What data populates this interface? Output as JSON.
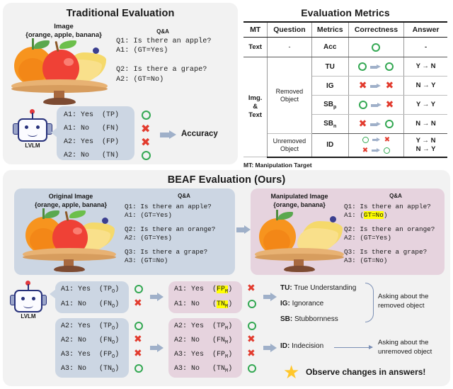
{
  "traditional": {
    "title": "Traditional Evaluation",
    "image_label_line1": "Image",
    "image_label_line2": "{orange, apple, banana}",
    "qa_label": "Q&A",
    "qa_text": "Q1: Is there an apple?\nA1: (GT=Yes)\n\nQ2: Is there a grape?\nA2: (GT=No)",
    "robot_label": "LVLM",
    "answers": [
      {
        "text": "A1: Yes  (TP)",
        "correct": "circle"
      },
      {
        "text": "A1: No   (FN)",
        "correct": "cross"
      },
      {
        "text": "A2: Yes  (FP)",
        "correct": "cross"
      },
      {
        "text": "A2: No   (TN)",
        "correct": "circle"
      }
    ],
    "result_label": "Accuracy"
  },
  "metrics": {
    "title": "Evaluation Metrics",
    "columns": [
      "MT",
      "Question",
      "Metrics",
      "Correctness",
      "Answer"
    ],
    "rows": [
      {
        "mt": "Text",
        "question": "-",
        "metric": "Acc",
        "metric_sub": "",
        "correctness": [
          "circle"
        ],
        "answer": "-"
      },
      {
        "mt": "Img.\n&\nText",
        "question": "Removed\nObject",
        "metric": "TU",
        "metric_sub": "",
        "correctness": [
          "circle",
          "arrow",
          "circle"
        ],
        "answer": "Y → N"
      },
      {
        "mt": "",
        "question": "",
        "metric": "IG",
        "metric_sub": "",
        "correctness": [
          "cross",
          "arrow",
          "cross"
        ],
        "answer": "N → Y"
      },
      {
        "mt": "",
        "question": "",
        "metric": "SB",
        "metric_sub": "p",
        "correctness": [
          "circle",
          "arrow",
          "cross"
        ],
        "answer": "Y → Y"
      },
      {
        "mt": "",
        "question": "",
        "metric": "SB",
        "metric_sub": "n",
        "correctness": [
          "cross",
          "arrow",
          "circle"
        ],
        "answer": "N → N"
      },
      {
        "mt": "",
        "question": "Unremoved\nObject",
        "metric": "ID",
        "metric_sub": "",
        "correctness": [
          "circle",
          "arrow",
          "cross",
          "cross",
          "arrow",
          "circle"
        ],
        "answer": "Y → N\nN → Y"
      }
    ],
    "footnote": "MT: Manipulation Target"
  },
  "beaf": {
    "title": "BEAF Evaluation (Ours)",
    "original": {
      "label_line1": "Original Image",
      "label_line2": "{orange, apple, banana}",
      "qa_label": "Q&A",
      "qa_lines": [
        "Q1: Is there an apple?",
        "A1: (GT=Yes)",
        "Q2: Is there an orange?",
        "A2: (GT=Yes)",
        "Q3: Is there a grape?",
        "A3: (GT=No)"
      ]
    },
    "manipulated": {
      "label_line1": "Manipulated Image",
      "label_line2": "{orange, banana}",
      "qa_label": "Q&A",
      "qa_lines": [
        "Q1: Is there an apple?",
        "A1: (GT=No)",
        "Q2: Is there an orange?",
        "A2: (GT=Yes)",
        "Q3: Is there a grape?",
        "A3: (GT=No)"
      ],
      "highlight_token": "GT=No"
    },
    "robot_label": "LVLM",
    "group1_original": [
      {
        "text": "A1: Yes  (TP",
        "sub": "O",
        "tail": ")",
        "correct": "circle",
        "highlight": false
      },
      {
        "text": "A1: No   (FN",
        "sub": "O",
        "tail": ")",
        "correct": "cross",
        "highlight": false
      }
    ],
    "group1_manipulated": [
      {
        "text": "A1: Yes  (FP",
        "sub": "M",
        "tail": ")",
        "correct": "cross",
        "highlight": true
      },
      {
        "text": "A1: No   (TN",
        "sub": "M",
        "tail": ")",
        "correct": "circle",
        "highlight": true
      }
    ],
    "group2_original": [
      {
        "text": "A2: Yes  (TP",
        "sub": "O",
        "tail": ")",
        "correct": "circle",
        "highlight": false
      },
      {
        "text": "A2: No   (FN",
        "sub": "O",
        "tail": ")",
        "correct": "cross",
        "highlight": false
      },
      {
        "text": "A3: Yes  (FP",
        "sub": "O",
        "tail": ")",
        "correct": "cross",
        "highlight": false
      },
      {
        "text": "A3: No   (TN",
        "sub": "O",
        "tail": ")",
        "correct": "circle",
        "highlight": false
      }
    ],
    "group2_manipulated": [
      {
        "text": "A2: Yes  (TP",
        "sub": "M",
        "tail": ")",
        "correct": "circle",
        "highlight": false
      },
      {
        "text": "A2: No   (FN",
        "sub": "M",
        "tail": ")",
        "correct": "cross",
        "highlight": false
      },
      {
        "text": "A3: Yes  (FP",
        "sub": "M",
        "tail": ")",
        "correct": "cross",
        "highlight": false
      },
      {
        "text": "A3: No   (TN",
        "sub": "M",
        "tail": ")",
        "correct": "circle",
        "highlight": false
      }
    ],
    "legend": [
      {
        "abbr": "TU:",
        "name": "True Understanding"
      },
      {
        "abbr": "IG:",
        "name": "Ignorance"
      },
      {
        "abbr": "SB:",
        "name": "Stubbornness"
      },
      {
        "abbr": "ID:",
        "name": "Indecision"
      }
    ],
    "note_removed": "Asking about the\nremoved object",
    "note_unremoved": "Asking about the\nunremoved object",
    "conclusion": "Observe changes in answers!",
    "star_glyph": "★"
  },
  "colors": {
    "green": "#34a853",
    "red": "#e23b2e",
    "blue_panel": "#ccd6e3",
    "pink_panel": "#e6d3de",
    "highlight": "#ffff00",
    "arrow": "#9fb0c9",
    "star": "#ffc72c"
  }
}
